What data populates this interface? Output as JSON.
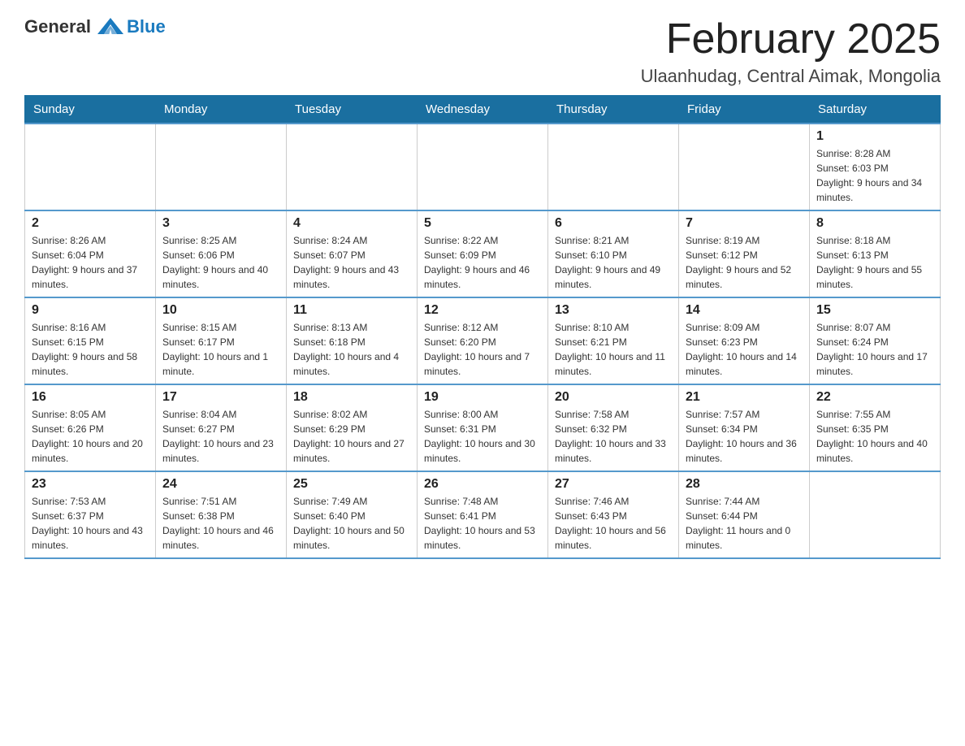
{
  "header": {
    "logo_text_general": "General",
    "logo_text_blue": "Blue",
    "month_title": "February 2025",
    "location": "Ulaanhudag, Central Aimak, Mongolia"
  },
  "days_of_week": [
    "Sunday",
    "Monday",
    "Tuesday",
    "Wednesday",
    "Thursday",
    "Friday",
    "Saturday"
  ],
  "weeks": [
    [
      {
        "day": "",
        "info": ""
      },
      {
        "day": "",
        "info": ""
      },
      {
        "day": "",
        "info": ""
      },
      {
        "day": "",
        "info": ""
      },
      {
        "day": "",
        "info": ""
      },
      {
        "day": "",
        "info": ""
      },
      {
        "day": "1",
        "info": "Sunrise: 8:28 AM\nSunset: 6:03 PM\nDaylight: 9 hours and 34 minutes."
      }
    ],
    [
      {
        "day": "2",
        "info": "Sunrise: 8:26 AM\nSunset: 6:04 PM\nDaylight: 9 hours and 37 minutes."
      },
      {
        "day": "3",
        "info": "Sunrise: 8:25 AM\nSunset: 6:06 PM\nDaylight: 9 hours and 40 minutes."
      },
      {
        "day": "4",
        "info": "Sunrise: 8:24 AM\nSunset: 6:07 PM\nDaylight: 9 hours and 43 minutes."
      },
      {
        "day": "5",
        "info": "Sunrise: 8:22 AM\nSunset: 6:09 PM\nDaylight: 9 hours and 46 minutes."
      },
      {
        "day": "6",
        "info": "Sunrise: 8:21 AM\nSunset: 6:10 PM\nDaylight: 9 hours and 49 minutes."
      },
      {
        "day": "7",
        "info": "Sunrise: 8:19 AM\nSunset: 6:12 PM\nDaylight: 9 hours and 52 minutes."
      },
      {
        "day": "8",
        "info": "Sunrise: 8:18 AM\nSunset: 6:13 PM\nDaylight: 9 hours and 55 minutes."
      }
    ],
    [
      {
        "day": "9",
        "info": "Sunrise: 8:16 AM\nSunset: 6:15 PM\nDaylight: 9 hours and 58 minutes."
      },
      {
        "day": "10",
        "info": "Sunrise: 8:15 AM\nSunset: 6:17 PM\nDaylight: 10 hours and 1 minute."
      },
      {
        "day": "11",
        "info": "Sunrise: 8:13 AM\nSunset: 6:18 PM\nDaylight: 10 hours and 4 minutes."
      },
      {
        "day": "12",
        "info": "Sunrise: 8:12 AM\nSunset: 6:20 PM\nDaylight: 10 hours and 7 minutes."
      },
      {
        "day": "13",
        "info": "Sunrise: 8:10 AM\nSunset: 6:21 PM\nDaylight: 10 hours and 11 minutes."
      },
      {
        "day": "14",
        "info": "Sunrise: 8:09 AM\nSunset: 6:23 PM\nDaylight: 10 hours and 14 minutes."
      },
      {
        "day": "15",
        "info": "Sunrise: 8:07 AM\nSunset: 6:24 PM\nDaylight: 10 hours and 17 minutes."
      }
    ],
    [
      {
        "day": "16",
        "info": "Sunrise: 8:05 AM\nSunset: 6:26 PM\nDaylight: 10 hours and 20 minutes."
      },
      {
        "day": "17",
        "info": "Sunrise: 8:04 AM\nSunset: 6:27 PM\nDaylight: 10 hours and 23 minutes."
      },
      {
        "day": "18",
        "info": "Sunrise: 8:02 AM\nSunset: 6:29 PM\nDaylight: 10 hours and 27 minutes."
      },
      {
        "day": "19",
        "info": "Sunrise: 8:00 AM\nSunset: 6:31 PM\nDaylight: 10 hours and 30 minutes."
      },
      {
        "day": "20",
        "info": "Sunrise: 7:58 AM\nSunset: 6:32 PM\nDaylight: 10 hours and 33 minutes."
      },
      {
        "day": "21",
        "info": "Sunrise: 7:57 AM\nSunset: 6:34 PM\nDaylight: 10 hours and 36 minutes."
      },
      {
        "day": "22",
        "info": "Sunrise: 7:55 AM\nSunset: 6:35 PM\nDaylight: 10 hours and 40 minutes."
      }
    ],
    [
      {
        "day": "23",
        "info": "Sunrise: 7:53 AM\nSunset: 6:37 PM\nDaylight: 10 hours and 43 minutes."
      },
      {
        "day": "24",
        "info": "Sunrise: 7:51 AM\nSunset: 6:38 PM\nDaylight: 10 hours and 46 minutes."
      },
      {
        "day": "25",
        "info": "Sunrise: 7:49 AM\nSunset: 6:40 PM\nDaylight: 10 hours and 50 minutes."
      },
      {
        "day": "26",
        "info": "Sunrise: 7:48 AM\nSunset: 6:41 PM\nDaylight: 10 hours and 53 minutes."
      },
      {
        "day": "27",
        "info": "Sunrise: 7:46 AM\nSunset: 6:43 PM\nDaylight: 10 hours and 56 minutes."
      },
      {
        "day": "28",
        "info": "Sunrise: 7:44 AM\nSunset: 6:44 PM\nDaylight: 11 hours and 0 minutes."
      },
      {
        "day": "",
        "info": ""
      }
    ]
  ]
}
